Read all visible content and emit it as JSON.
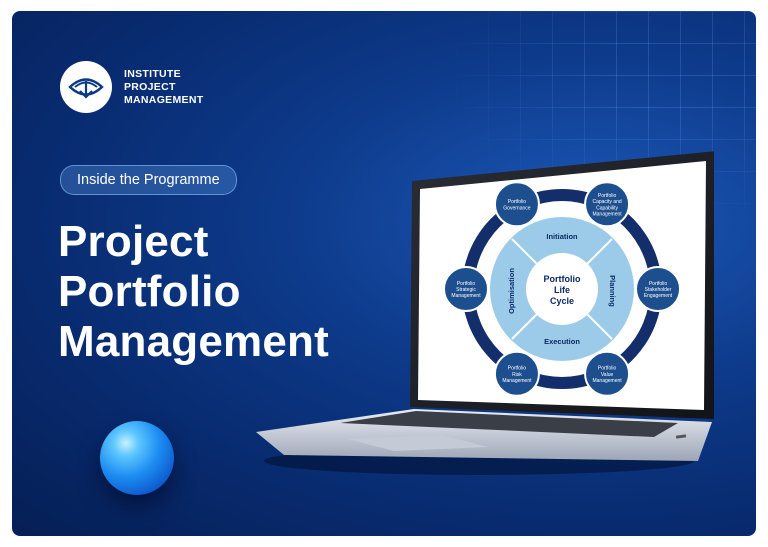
{
  "brand": {
    "line1": "INSTITUTE",
    "line2": "PROJECT",
    "line3": "MANAGEMENT"
  },
  "badge": "Inside the Programme",
  "headline": {
    "line1": "Project",
    "line2": "Portfolio",
    "line3": "Management"
  },
  "diagram": {
    "center_line1": "Portfolio",
    "center_line2": "Life",
    "center_line3": "Cycle",
    "phases": {
      "top": "Initiation",
      "right": "Planning",
      "bottom": "Execution",
      "left": "Optimisation"
    },
    "nodes": [
      {
        "lines": [
          "Portfolio",
          "Governance"
        ]
      },
      {
        "lines": [
          "Portfolio",
          "Capacity and",
          "Capability",
          "Management"
        ]
      },
      {
        "lines": [
          "Portfolio",
          "Stakeholder",
          "Engagement"
        ]
      },
      {
        "lines": [
          "Portfolio",
          "Value",
          "Management"
        ]
      },
      {
        "lines": [
          "Portfolio",
          "Risk",
          "Management"
        ]
      },
      {
        "lines": [
          "Portfolio",
          "Strategic",
          "Management"
        ]
      }
    ]
  },
  "colors": {
    "background": "#0a2f78",
    "accent": "#1c8cf2",
    "diagram_ring": "#132a66",
    "diagram_node": "#1d4f8f",
    "diagram_inner": "#a9d3ef"
  }
}
